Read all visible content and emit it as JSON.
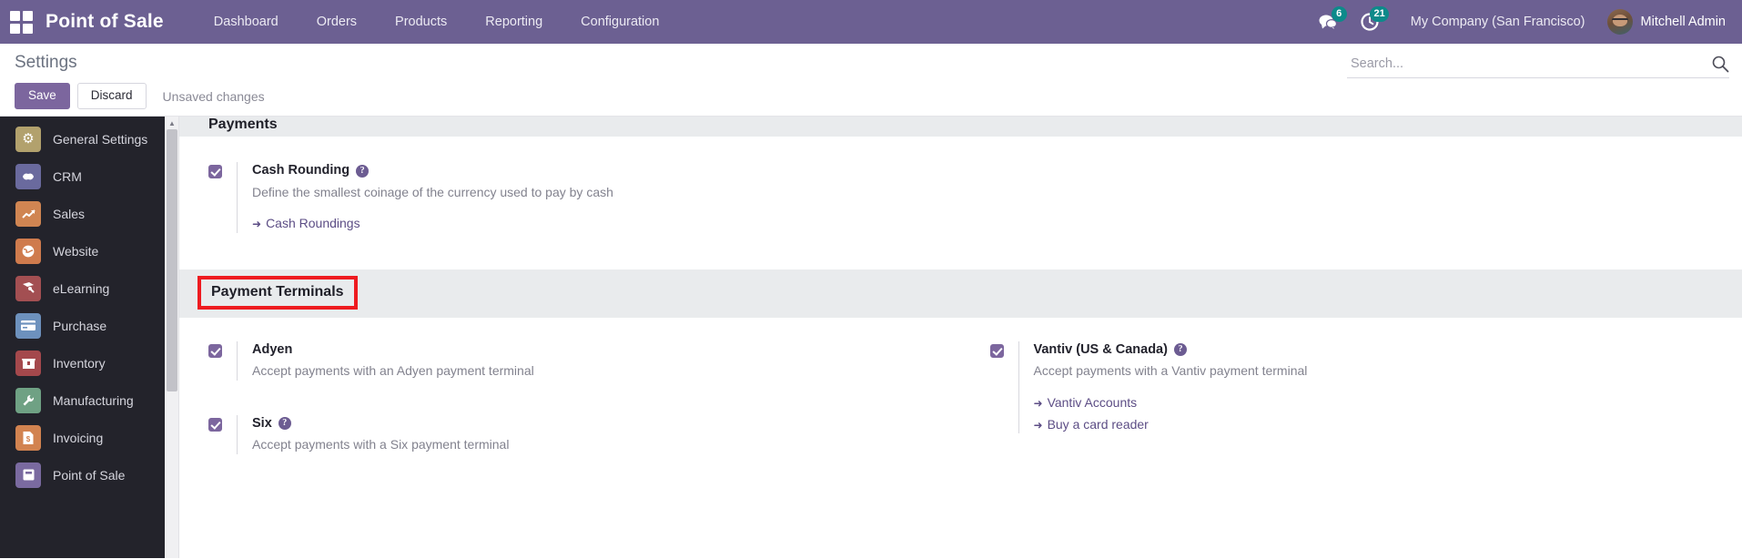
{
  "navbar": {
    "apps_icon": "apps-grid-icon",
    "brand": "Point of Sale",
    "menu": [
      {
        "label": "Dashboard"
      },
      {
        "label": "Orders"
      },
      {
        "label": "Products"
      },
      {
        "label": "Reporting"
      },
      {
        "label": "Configuration"
      }
    ],
    "messages_icon": "messages-icon",
    "messages_count": "6",
    "activities_icon": "activities-clock-icon",
    "activities_count": "21",
    "company": "My Company (San Francisco)",
    "avatar_name": "avatar",
    "user": "Mitchell Admin",
    "accent": "#6c6092",
    "badge_color": "#0d8a8a"
  },
  "control_panel": {
    "title": "Settings",
    "save_label": "Save",
    "discard_label": "Discard",
    "status": "Unsaved changes",
    "search_placeholder": "Search...",
    "search_value": "",
    "search_icon": "search-icon"
  },
  "sidebar": {
    "items": [
      {
        "label": "General Settings",
        "icon": "gear-icon",
        "glyph": "⚙",
        "color": "#b2a16d"
      },
      {
        "label": "CRM",
        "icon": "handshake-icon",
        "glyph": "⚓",
        "color": "#6a6a9e"
      },
      {
        "label": "Sales",
        "icon": "chart-arrow-icon",
        "glyph": "↗",
        "color": "#d08552"
      },
      {
        "label": "Website",
        "icon": "globe-icon",
        "glyph": "◕",
        "color": "#cf7b4d"
      },
      {
        "label": "eLearning",
        "icon": "graduation-icon",
        "glyph": "✒",
        "color": "#a34f52"
      },
      {
        "label": "Purchase",
        "icon": "credit-card-icon",
        "glyph": "▬",
        "color": "#6d91bd"
      },
      {
        "label": "Inventory",
        "icon": "box-icon",
        "glyph": "▤",
        "color": "#a4484c"
      },
      {
        "label": "Manufacturing",
        "icon": "wrench-icon",
        "glyph": "⚒",
        "color": "#6fa184"
      },
      {
        "label": "Invoicing",
        "icon": "invoice-dollar-icon",
        "glyph": "$",
        "color": "#d28350"
      },
      {
        "label": "Point of Sale",
        "icon": "pos-icon",
        "glyph": "▣",
        "color": "#7a6aa0"
      }
    ]
  },
  "settings": {
    "payments_section": {
      "title": "Payments",
      "items": [
        {
          "name": "Cash Rounding",
          "checked": true,
          "has_help": true,
          "description": "Define the smallest coinage of the currency used to pay by cash",
          "links": [
            {
              "label": "Cash Roundings"
            }
          ]
        }
      ]
    },
    "payment_terminals_section": {
      "title": "Payment Terminals",
      "highlighted": true,
      "highlight_color": "#ee1b20",
      "left_items": [
        {
          "name": "Adyen",
          "checked": true,
          "has_help": false,
          "description": "Accept payments with an Adyen payment terminal",
          "links": []
        },
        {
          "name": "Six",
          "checked": true,
          "has_help": true,
          "description": "Accept payments with a Six payment terminal",
          "links": []
        }
      ],
      "right_items": [
        {
          "name": "Vantiv (US & Canada)",
          "checked": true,
          "has_help": true,
          "description": "Accept payments with a Vantiv payment terminal",
          "links": [
            {
              "label": "Vantiv Accounts"
            },
            {
              "label": "Buy a card reader"
            }
          ]
        }
      ]
    }
  }
}
